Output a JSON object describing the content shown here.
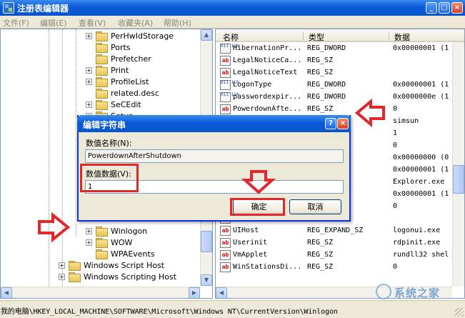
{
  "window": {
    "title": "注册表编辑器",
    "controls": [
      "_",
      "□",
      "×"
    ]
  },
  "menu": [
    {
      "label": "文件(F)"
    },
    {
      "label": "编辑(E)"
    },
    {
      "label": "查看(V)"
    },
    {
      "label": "收藏夹(A)"
    },
    {
      "label": "帮助(H)"
    }
  ],
  "tree": [
    {
      "label": "PerHwIdStorage",
      "expander": "+"
    },
    {
      "label": "Ports",
      "expander": ""
    },
    {
      "label": "Prefetcher",
      "expander": ""
    },
    {
      "label": "Print",
      "expander": "+"
    },
    {
      "label": "ProfileList",
      "expander": "+"
    },
    {
      "label": "related.desc",
      "expander": ""
    },
    {
      "label": "SeCEdit",
      "expander": "+"
    },
    {
      "label": "Setup",
      "expander": "+"
    },
    {
      "label": "Winlogon",
      "expander": "+"
    },
    {
      "label": "WOW",
      "expander": "+"
    },
    {
      "label": "WPAEvents",
      "expander": ""
    },
    {
      "label": "Windows Script Host",
      "expander": "+"
    },
    {
      "label": "Windows Scripting Host",
      "expander": "+"
    }
  ],
  "list": {
    "headers": {
      "name": "名称",
      "type": "类型",
      "data": "数据"
    },
    "rows": [
      {
        "icon": "binary",
        "name": "HibernationPr...",
        "type": "REG_DWORD",
        "data": "0x00000001 (1"
      },
      {
        "icon": "string",
        "name": "LegalNoticeCa...",
        "type": "REG_SZ",
        "data": ""
      },
      {
        "icon": "string",
        "name": "LegalNoticeText",
        "type": "REG_SZ",
        "data": ""
      },
      {
        "icon": "binary",
        "name": "LogonType",
        "type": "REG_DWORD",
        "data": "0x00000001 (1"
      },
      {
        "icon": "binary",
        "name": "passwordexpir...",
        "type": "REG_DWORD",
        "data": "0x0000000e (1"
      },
      {
        "icon": "string",
        "name": "PowerdownAfte...",
        "type": "REG_SZ",
        "data": "0"
      },
      {
        "icon": "string",
        "name": "",
        "type": "",
        "data": "simsun"
      },
      {
        "icon": "string",
        "name": "",
        "type": "",
        "data": "1"
      },
      {
        "icon": "string",
        "name": "",
        "type": "",
        "data": "0"
      },
      {
        "icon": "binary",
        "name": "",
        "type": "",
        "data": "0x00000000 (0"
      },
      {
        "icon": "binary",
        "name": "",
        "type": "",
        "data": "0x00000001 (1"
      },
      {
        "icon": "string",
        "name": "",
        "type": "",
        "data": "Explorer.exe"
      },
      {
        "icon": "binary",
        "name": "",
        "type": "",
        "data": "0x00000001 (1"
      },
      {
        "icon": "string",
        "name": "",
        "type": "",
        "data": "0"
      },
      {
        "icon": "string",
        "name": "",
        "type": "",
        "data": ""
      },
      {
        "icon": "string",
        "name": "UIHost",
        "type": "REG_EXPAND_SZ",
        "data": "logonui.exe"
      },
      {
        "icon": "string",
        "name": "Userinit",
        "type": "REG_SZ",
        "data": "rdpinit.exe"
      },
      {
        "icon": "string",
        "name": "VmApplet",
        "type": "REG_SZ",
        "data": "rundll32 shel"
      },
      {
        "icon": "string",
        "name": "WinStationsDi...",
        "type": "REG_SZ",
        "data": "0"
      }
    ]
  },
  "dialog": {
    "title": "编辑字符串",
    "controls": [
      "?",
      "×"
    ],
    "name_label": "数值名称(N):",
    "name_value": "PowerdownAfterShutdown",
    "data_label": "数值数据(V):",
    "data_value": "1",
    "ok_label": "确定",
    "cancel_label": "取消"
  },
  "statusbar": {
    "path": "我的电脑\\HKEY_LOCAL_MACHINE\\SOFTWARE\\Microsoft\\Windows NT\\CurrentVersion\\Winlogon"
  },
  "icons": {
    "string_value": "ab",
    "binary_value": "011 110"
  },
  "colors": {
    "titlebar": "#0a5ad8",
    "annotation": "#e0282a",
    "window_face": "#ece9d8"
  }
}
